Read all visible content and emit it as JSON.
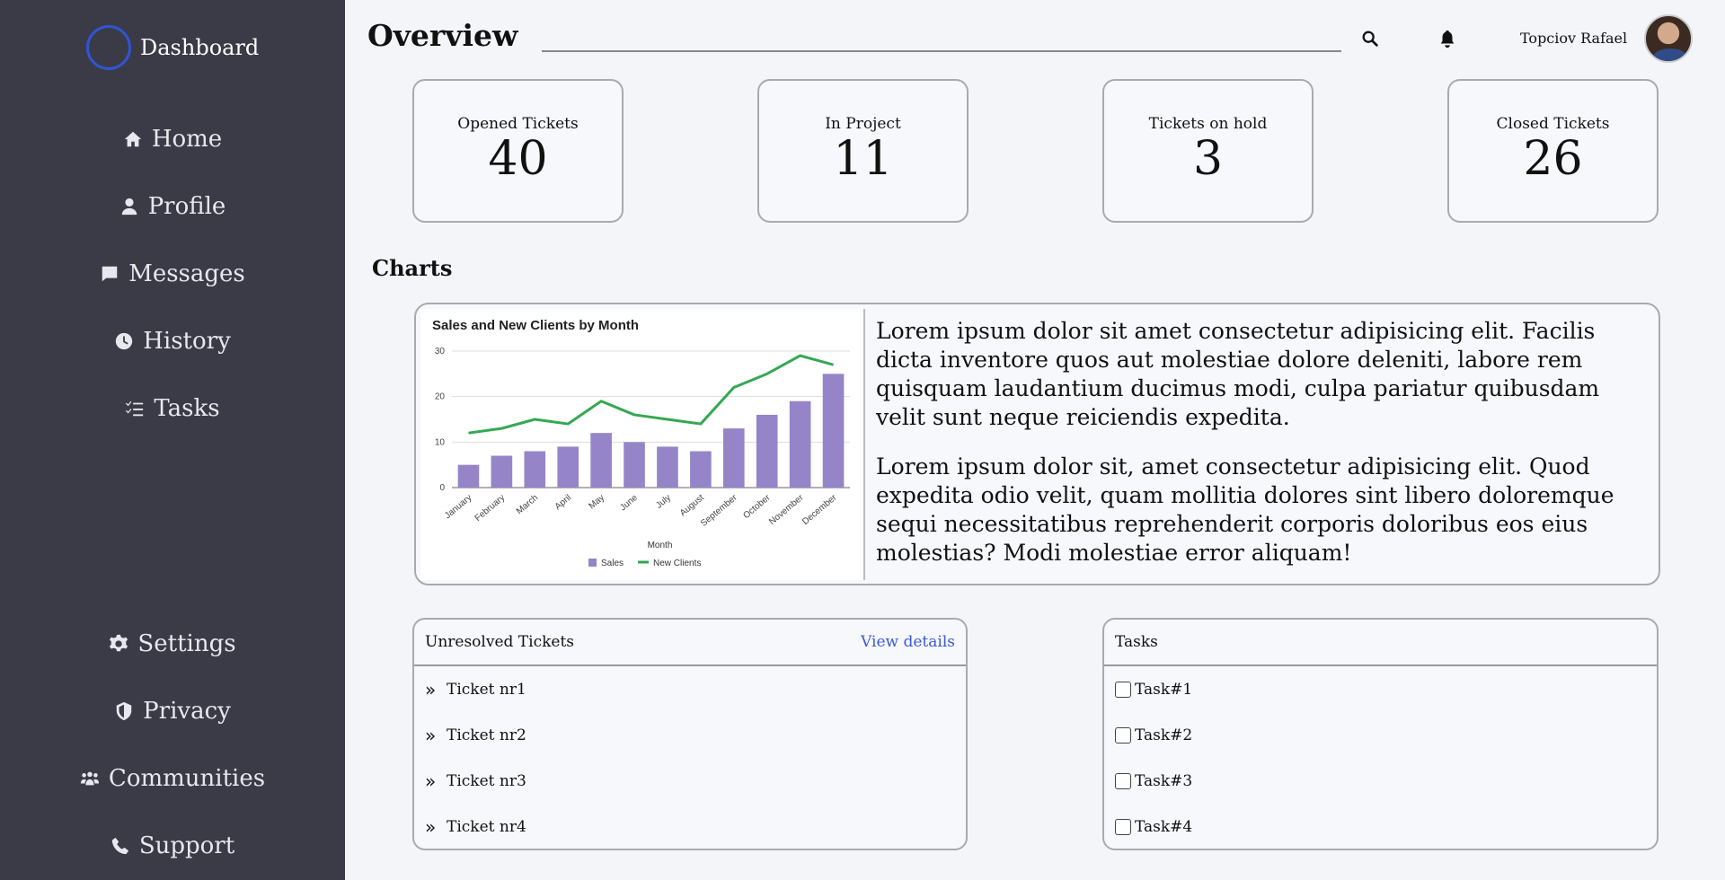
{
  "sidebar": {
    "brand": "Dashboard",
    "items": [
      {
        "label": "Home",
        "icon": "home-icon"
      },
      {
        "label": "Profile",
        "icon": "user-icon"
      },
      {
        "label": "Messages",
        "icon": "message-icon"
      },
      {
        "label": "History",
        "icon": "clock-icon"
      },
      {
        "label": "Tasks",
        "icon": "list-check-icon"
      }
    ],
    "bottom_items": [
      {
        "label": "Settings",
        "icon": "gear-icon"
      },
      {
        "label": "Privacy",
        "icon": "shield-icon"
      },
      {
        "label": "Communities",
        "icon": "people-icon"
      },
      {
        "label": "Support",
        "icon": "phone-icon"
      }
    ]
  },
  "header": {
    "title": "Overview",
    "search_placeholder": "",
    "user_name": "Topciov Rafael"
  },
  "stats": [
    {
      "label": "Opened Tickets",
      "value": "40"
    },
    {
      "label": "In Project",
      "value": "11"
    },
    {
      "label": "Tickets on hold",
      "value": "3"
    },
    {
      "label": "Closed Tickets",
      "value": "26"
    }
  ],
  "charts_heading": "Charts",
  "chart_data": {
    "type": "bar",
    "title": "Sales and New Clients by Month",
    "xlabel": "Month",
    "ylabel": "",
    "ylim": [
      0,
      30
    ],
    "yticks": [
      0,
      10,
      20,
      30
    ],
    "categories": [
      "January",
      "February",
      "March",
      "April",
      "May",
      "June",
      "July",
      "August",
      "September",
      "October",
      "November",
      "December"
    ],
    "series": [
      {
        "name": "Sales",
        "type": "bar",
        "color": "#9585c8",
        "values": [
          5,
          7,
          8,
          9,
          12,
          10,
          9,
          8,
          13,
          16,
          19,
          25
        ]
      },
      {
        "name": "New Clients",
        "type": "line",
        "color": "#34a853",
        "values": [
          12,
          13,
          15,
          14,
          19,
          16,
          15,
          14,
          22,
          25,
          29,
          27
        ]
      }
    ],
    "grid": true,
    "legend": "bottom"
  },
  "text": {
    "p1": "Lorem ipsum dolor sit amet consectetur adipisicing elit. Facilis dicta inventore quos aut molestiae dolore deleniti, labore rem quisquam laudantium ducimus modi, culpa pariatur quibusdam velit sunt neque reiciendis expedita.",
    "p2": "Lorem ipsum dolor sit, amet consectetur adipisicing elit. Quod expedita odio velit, quam mollitia dolores sint libero doloremque sequi necessitatibus reprehenderit corporis doloribus eos eius molestias? Modi molestiae error aliquam!"
  },
  "unresolved": {
    "title": "Unresolved Tickets",
    "link": "View details",
    "items": [
      "Ticket nr1",
      "Ticket nr2",
      "Ticket nr3",
      "Ticket nr4"
    ]
  },
  "tasks": {
    "title": "Tasks",
    "items": [
      "Task#1",
      "Task#2",
      "Task#3",
      "Task#4"
    ]
  },
  "colors": {
    "sidebar_bg": "#3a3b47",
    "page_bg": "#f3f5f9",
    "accent": "#3b58d8"
  }
}
